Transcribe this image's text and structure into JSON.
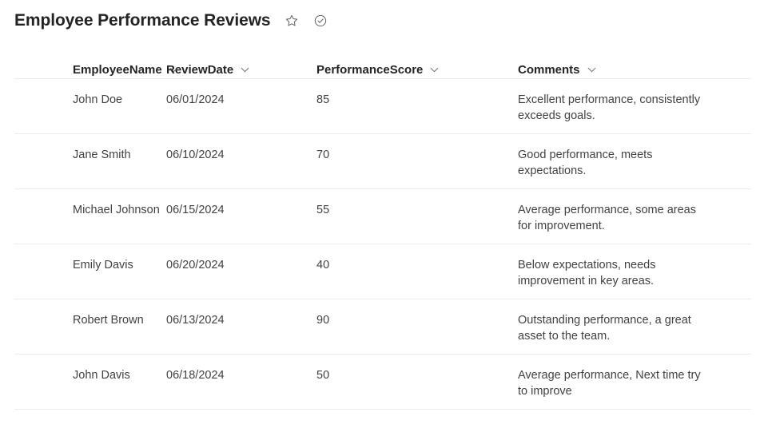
{
  "header": {
    "title": "Employee Performance Reviews",
    "icons": [
      {
        "name": "favorite-star-icon",
        "glyph": "star"
      },
      {
        "name": "published-check-icon",
        "glyph": "check-circle"
      }
    ]
  },
  "table": {
    "columns": [
      {
        "key": "employee_name",
        "label": "EmployeeName",
        "sort_icon": "chevron-down-icon"
      },
      {
        "key": "review_date",
        "label": "ReviewDate",
        "sort_icon": "chevron-down-icon"
      },
      {
        "key": "performance_score",
        "label": "PerformanceScore",
        "sort_icon": "chevron-down-icon"
      },
      {
        "key": "comments",
        "label": "Comments",
        "sort_icon": "chevron-down-icon"
      }
    ],
    "rows": [
      {
        "employee_name": "John Doe",
        "review_date": "06/01/2024",
        "performance_score": "85",
        "comments": "Excellent performance, consistently exceeds goals."
      },
      {
        "employee_name": "Jane Smith",
        "review_date": "06/10/2024",
        "performance_score": "70",
        "comments": "Good performance, meets expectations."
      },
      {
        "employee_name": "Michael Johnson",
        "review_date": "06/15/2024",
        "performance_score": "55",
        "comments": "Average performance, some areas for improvement."
      },
      {
        "employee_name": "Emily Davis",
        "review_date": "06/20/2024",
        "performance_score": "40",
        "comments": "Below expectations, needs improvement in key areas."
      },
      {
        "employee_name": "Robert Brown",
        "review_date": "06/13/2024",
        "performance_score": "90",
        "comments": "Outstanding performance, a great asset to the team."
      },
      {
        "employee_name": "John Davis",
        "review_date": "06/18/2024",
        "performance_score": "50",
        "comments": "Average performance, Next time try to improve"
      }
    ]
  },
  "colors": {
    "page_background": "#ffffff",
    "title_text": "#242424",
    "cell_text": "#424242",
    "divider": "#ebebeb",
    "icon_stroke": "#616161"
  }
}
